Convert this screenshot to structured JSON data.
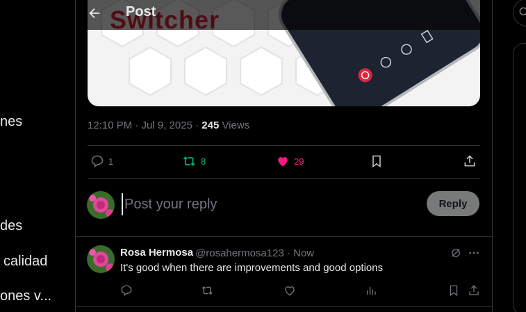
{
  "left_nav": {
    "items": [
      "nes",
      "des",
      "calidad",
      "ones v..."
    ]
  },
  "header": {
    "title": "Post"
  },
  "media": {
    "text": "Switcher"
  },
  "post": {
    "time": "12:10 PM · Jul 9, 2025 · ",
    "views_count": "245",
    "views_label": " Views",
    "replies": "1",
    "reposts": "8",
    "likes": "29"
  },
  "composer": {
    "placeholder": "Post your reply",
    "button_label": "Reply"
  },
  "reply": {
    "name": "Rosa Hermosa",
    "handle": "@rosahermosa123 · Now",
    "text": "It's good when there are improvements and good options"
  },
  "colors": {
    "repost_green": "#00ba7c",
    "like_pink": "#f91880",
    "muted": "#71767b",
    "border": "#2f3336"
  }
}
